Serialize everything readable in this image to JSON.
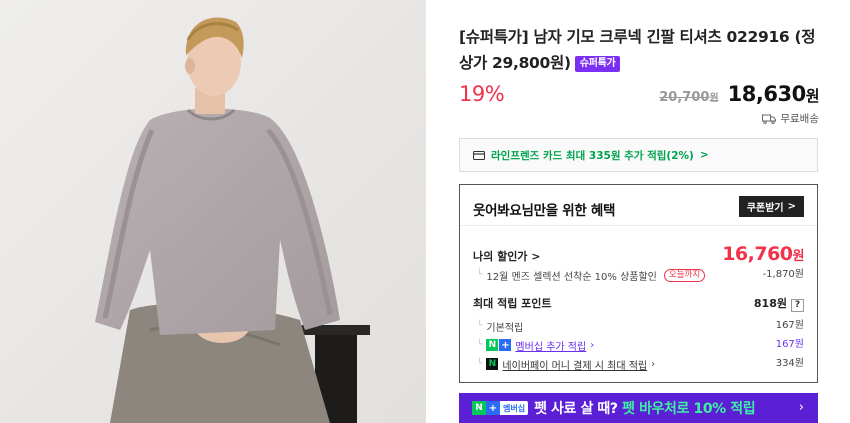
{
  "product": {
    "title": "[슈퍼특가] 남자 기모 크루넥 긴팔 티셔츠 022916 (정상가 29,800원)",
    "badge": "슈퍼특가",
    "discount_rate": "19%",
    "original_price": "20,700",
    "original_unit": "원",
    "final_price": "18,630",
    "final_unit": "원",
    "shipping": "무료배송"
  },
  "card_benefit": {
    "text": "라인프렌즈 카드 최대 335원 추가 적립(2%)",
    "chevron": ">"
  },
  "benefit_box": {
    "heading": "웃어봐요님만을 위한 혜택",
    "coupon_button": "쿠폰받기",
    "coupon_chevron": ">",
    "my_price_label": "나의 할인가",
    "my_price_chevron": ">",
    "my_price_value": "16,760",
    "my_price_unit": "원",
    "coupon_line": "12월 멘즈 셀렉션 선착순 10% 상품할인",
    "coupon_tag": "오늘까지",
    "coupon_discount": "-1,870원",
    "points_label": "최대 적립 포인트",
    "points_value": "818원",
    "points_help": "?",
    "basic_label": "기본적립",
    "basic_value": "167원",
    "membership_label": "멤버십 추가 적립",
    "membership_value": "167원",
    "naverpay_label": "네이버페이 머니 결제 시 최대 적립",
    "naverpay_value": "334원"
  },
  "promo": {
    "tag_text": "멤버십",
    "text_prefix": "펫 사료 살 때?",
    "text_highlight": "펫 바우처로 10% 적립",
    "arrow": "›"
  },
  "colors": {
    "accent_red": "#f0334b",
    "badge_purple": "#7b2ff2",
    "promo_purple": "#5b1fd6",
    "naver_green": "#03c75a",
    "card_green": "#00a34e"
  },
  "icons": [
    "card-icon",
    "truck-icon",
    "chevron-right-icon",
    "naver-n-icon",
    "plus-icon"
  ]
}
